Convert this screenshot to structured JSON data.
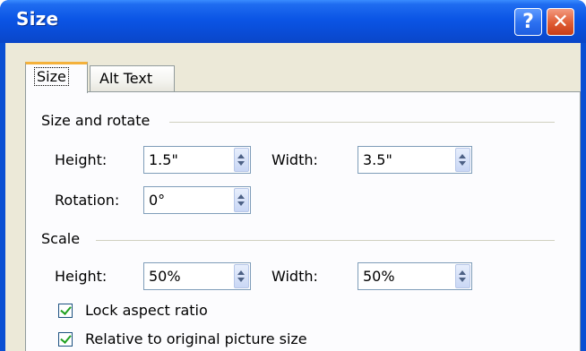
{
  "window": {
    "title": "Size",
    "help_glyph": "?",
    "close_glyph": "✕"
  },
  "tabs": [
    {
      "label": "Size",
      "active": true
    },
    {
      "label": "Alt Text",
      "active": false
    }
  ],
  "size_rotate": {
    "heading": "Size and rotate",
    "height_label": "Height:",
    "height_value": "1.5\"",
    "width_label": "Width:",
    "width_value": "3.5\"",
    "rotation_label": "Rotation:",
    "rotation_value": "0°"
  },
  "scale": {
    "heading": "Scale",
    "height_label": "Height:",
    "height_value": "50%",
    "width_label": "Width:",
    "width_value": "50%",
    "lock_aspect_label": "Lock aspect ratio",
    "lock_aspect_checked": true,
    "relative_label": "Relative to original picture size",
    "relative_checked": true
  },
  "colors": {
    "title_bar": "#0a4fd3",
    "dialog_bg": "#ece9d8",
    "tab_accent": "#f4b13b",
    "check_mark": "#21a121"
  }
}
